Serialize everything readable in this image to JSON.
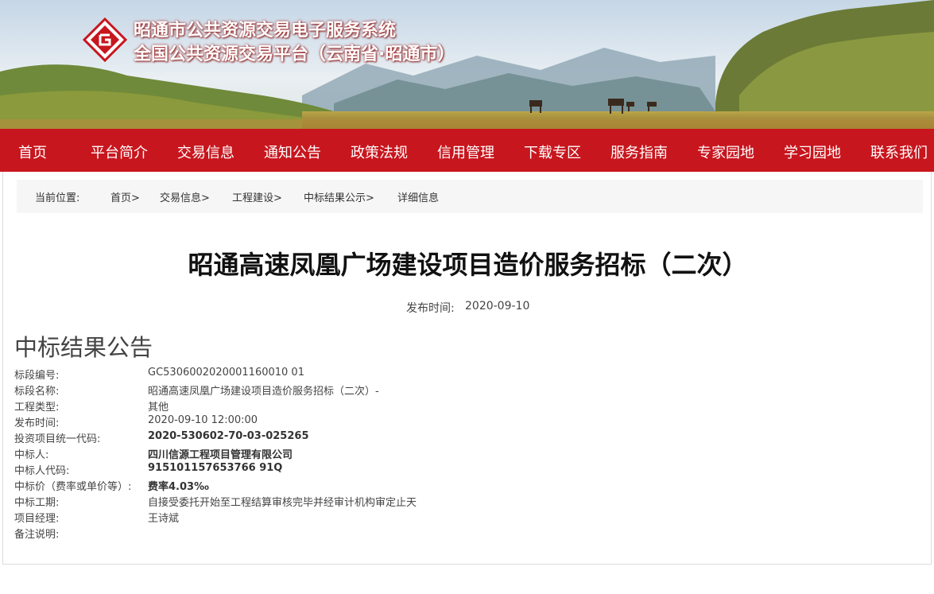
{
  "header": {
    "title_line1": "昭通市公共资源交易电子服务系统",
    "title_line2": "全国公共资源交易平台（云南省·昭通市）",
    "logo_icon": "ztggzy-logo-icon",
    "brand_color": "#c8161e"
  },
  "nav": {
    "items": [
      "首页",
      "平台简介",
      "交易信息",
      "通知公告",
      "政策法规",
      "信用管理",
      "下载专区",
      "服务指南",
      "专家园地",
      "学习园地",
      "联系我们"
    ]
  },
  "breadcrumb": {
    "label": "当前位置:",
    "items": [
      "首页>",
      "交易信息>",
      "工程建设>",
      "中标结果公示>",
      "详细信息"
    ]
  },
  "article": {
    "title": "昭通高速凤凰广场建设项目造价服务招标（二次）",
    "publish_label": "发布时间:",
    "publish_date": "2020-09-10",
    "section_heading": "中标结果公告",
    "fields": [
      {
        "label": "标段编号:",
        "value": "GC5306002020001160010 01"
      },
      {
        "label": "标段名称:",
        "value": "昭通高速凤凰广场建设项目造价服务招标（二次）-"
      },
      {
        "label": "工程类型:",
        "value": "其他"
      },
      {
        "label": "发布时间:",
        "value": "2020-09-10 12:00:00"
      },
      {
        "label": "投资项目统一代码:",
        "value": "2020-530602-70-03-025265"
      },
      {
        "label": "中标人:",
        "value": "四川信源工程项目管理有限公司"
      },
      {
        "label": "中标人代码:",
        "value": "915101157653766 91Q"
      },
      {
        "label": "中标价（费率或单价等）:",
        "value": "费率4.03‰"
      },
      {
        "label": "中标工期:",
        "value": "自接受委托开始至工程结算审核完毕并经审计机构审定止天"
      },
      {
        "label": "项目经理:",
        "value": "王诗斌"
      },
      {
        "label": "备注说明:",
        "value": ""
      }
    ]
  }
}
